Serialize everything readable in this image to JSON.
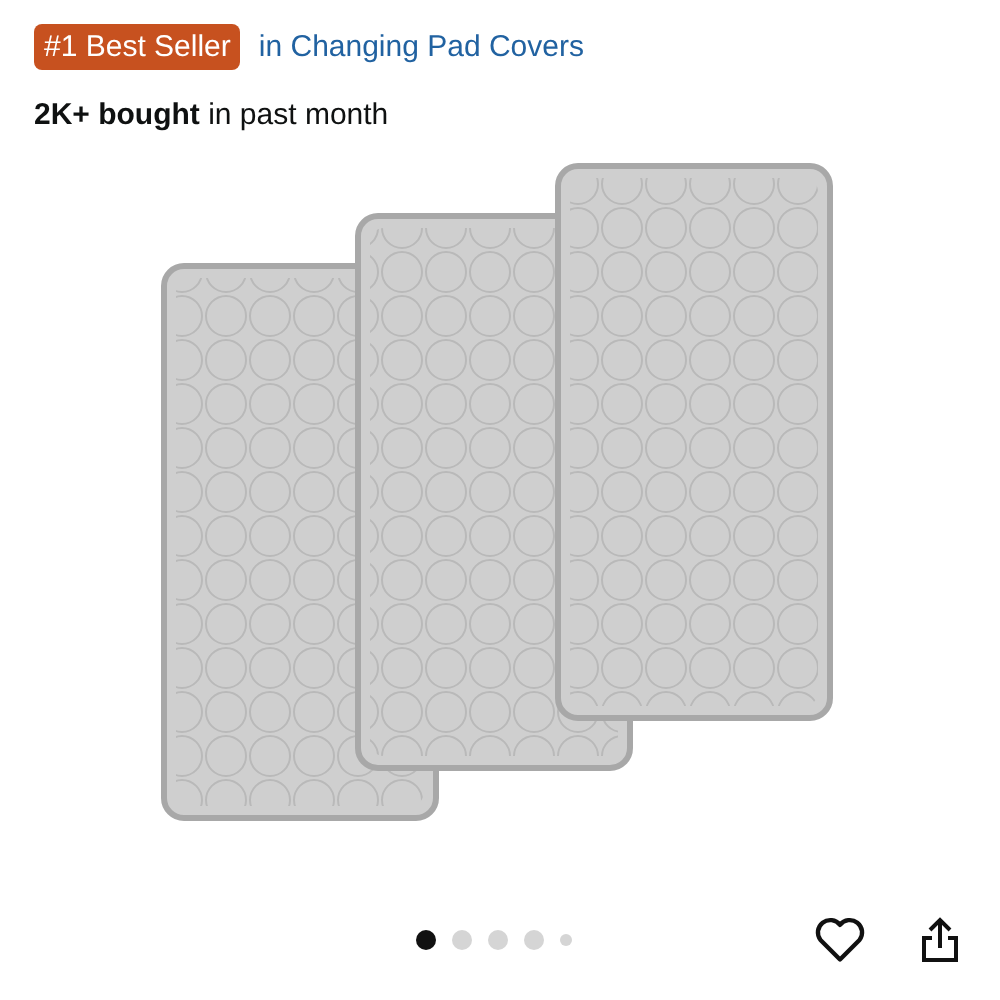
{
  "badge": {
    "label": "#1 Best Seller",
    "category_link": "in Changing Pad Covers"
  },
  "purchases": "**2K+ bought** in past month",
  "carousel_dots": [
    {
      "selected": true
    },
    {
      "selected": false
    },
    {
      "selected": false
    },
    {
      "selected": false
    },
    {
      "selected": false
    }
  ]
}
